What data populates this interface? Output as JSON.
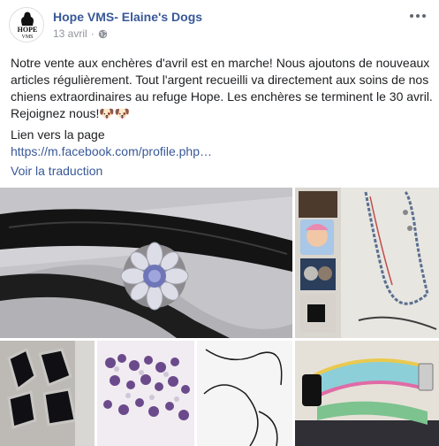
{
  "post": {
    "page_name": "Hope VMS- Elaine's Dogs",
    "date": "13 avril",
    "separator": "·",
    "text": "Notre vente aux enchères d'avril est en marche! Nous ajoutons de nouveaux articles régulièrement. Tout l'argent recueilli va directement aux soins de nos chiens extraordinaires au refuge Hope. Les enchères se terminent le 30 avril. Rejoignez nous!🐶🐶",
    "link_label": "Lien vers la page",
    "link_url": "https://m.facebook.com/profile.php…",
    "translate_label": "Voir la traduction"
  },
  "icons": {
    "privacy": "globe-icon",
    "menu": "more-options-icon"
  },
  "colors": {
    "link": "#385898",
    "meta": "#90949c",
    "text": "#1c1e21"
  }
}
